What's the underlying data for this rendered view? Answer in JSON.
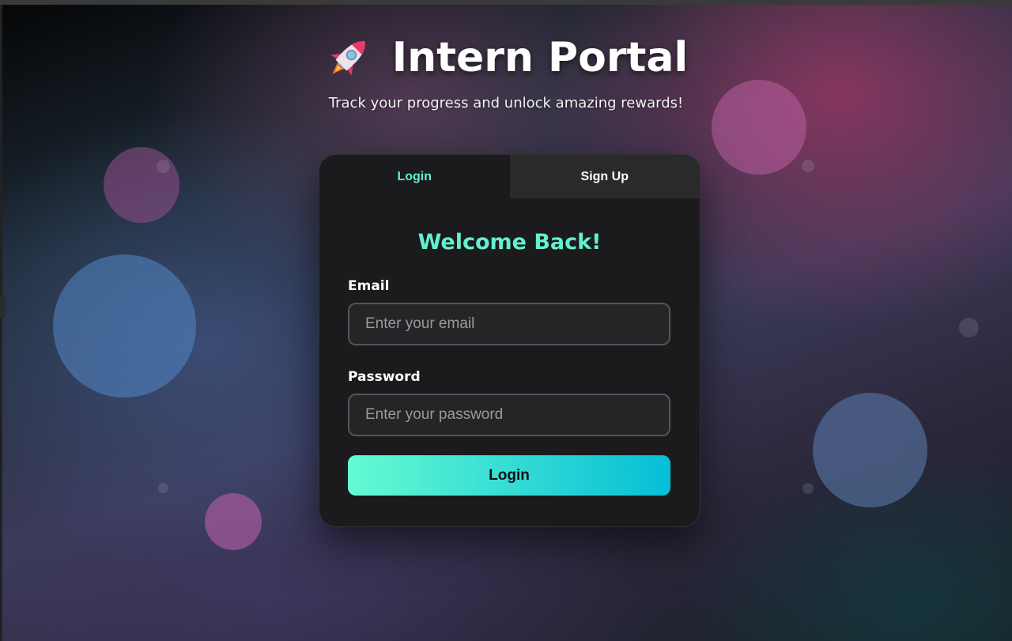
{
  "header": {
    "title": "Intern Portal",
    "subtitle": "Track your progress and unlock amazing rewards!",
    "icon": "rocket-icon"
  },
  "tabs": [
    {
      "label": "Login",
      "active": true
    },
    {
      "label": "Sign Up",
      "active": false
    }
  ],
  "form": {
    "heading": "Welcome Back!",
    "email_label": "Email",
    "email_placeholder": "Enter your email",
    "email_value": "",
    "password_label": "Password",
    "password_placeholder": "Enter your password",
    "password_value": "",
    "submit_label": "Login"
  },
  "colors": {
    "accent": "#5ef2cf",
    "button_gradient_start": "#64fbd2",
    "button_gradient_end": "#06bed6",
    "card_background": "#1b1b1d"
  }
}
